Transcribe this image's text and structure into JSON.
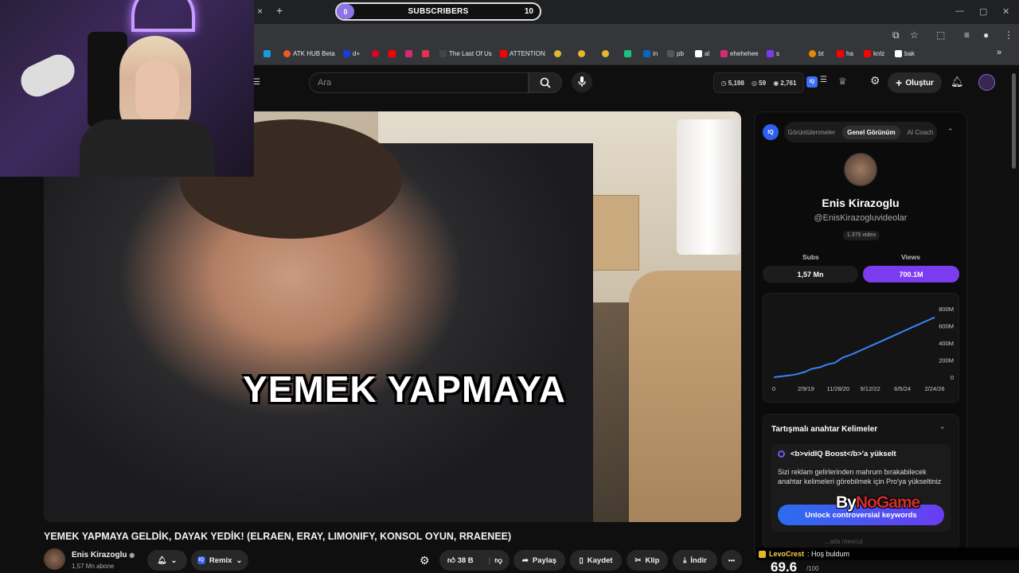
{
  "browser": {
    "tab_close": "×",
    "new_tab": "+",
    "subscribers_widget": {
      "current": "0",
      "label": "SUBSCRIBERS",
      "goal": "10"
    },
    "bookmarks": [
      {
        "label": "ATK HUB Beta",
        "color": "#f05a24"
      },
      {
        "label": "d+",
        "color": "#1a3bd6"
      },
      {
        "label": "",
        "color": "#e60023"
      },
      {
        "label": "",
        "color": "#d62976"
      },
      {
        "label": "",
        "color": "#e5334b"
      },
      {
        "label": "The Last Of Us",
        "color": "#444"
      },
      {
        "label": "ATTENTION",
        "color": "#ff0000"
      },
      {
        "label": "in",
        "color": "#0a66c2"
      },
      {
        "label": "pb",
        "color": "#555"
      },
      {
        "label": "al",
        "color": "#fff"
      },
      {
        "label": "ehehehee",
        "color": "#d62976"
      },
      {
        "label": "s",
        "color": "#7b3cf0"
      },
      {
        "label": "bt",
        "color": "#e58a00"
      },
      {
        "label": "ha",
        "color": "#ff0000"
      },
      {
        "label": "knlz",
        "color": "#ff0000"
      },
      {
        "label": "bak",
        "color": "#fff"
      }
    ],
    "overflow": "»"
  },
  "youtube": {
    "search_placeholder": "Ara",
    "stats": {
      "a": "5,198",
      "b": "59",
      "c": "2,761"
    },
    "iq": "IQ",
    "create_label": "Oluştur"
  },
  "video": {
    "caption": "YEMEK YAPMAYA",
    "title": "YEMEK YAPMAYA GELDİK, DAYAK YEDİK! (ELRAEN, ERAY, LIMONIFY, KONSOL OYUN, RRAENEE)",
    "channel": "Enis Kirazoglu",
    "subscribers": "1,57 Mn abone",
    "remix": "Remix",
    "likes": "38 B",
    "share": "Paylaş",
    "save": "Kaydet",
    "clip": "Klip",
    "download": "İndir",
    "more": "•••"
  },
  "sidebar": {
    "logo": "IQ",
    "tabs": [
      "Görüntülenmeler",
      "Genel Görünüm",
      "AI Coach"
    ],
    "active_tab": 1,
    "name": "Enis Kirazoglu",
    "handle": "@EnisKirazogluvideolar",
    "video_count": "1.375 video",
    "subs_label": "Subs",
    "subs_value": "1,57 Mn",
    "views_label": "Views",
    "views_value": "700.1M",
    "keywords_title": "Tartışmalı anahtar Kelimeler",
    "boost_title": "<b>vidIQ Boost</b>'a yükselt",
    "boost_desc": "Sizi reklam gelirlerinden mahrum bırakabilecek anahtar kelimeleri görebilmek için Pro'ya yükseltiniz",
    "unlock_label": "Unlock controversial keywords",
    "faint_text": "...atla mevcut",
    "score": "69.6",
    "score_max": "/100"
  },
  "chat": {
    "user": "LevoCrest",
    "message": ": Hoş buldum"
  },
  "watermark": {
    "a": "By",
    "b": "NoGame"
  },
  "chart_data": {
    "type": "line",
    "x_ticks": [
      "0",
      "2/9/19",
      "11/28/20",
      "9/12/22",
      "6/5/24",
      "2/24/26"
    ],
    "y_ticks": [
      "800M",
      "600M",
      "400M",
      "200M",
      "0"
    ],
    "ylim": [
      0,
      800
    ],
    "series": [
      {
        "values": [
          0,
          10,
          20,
          35,
          60,
          100,
          115,
          150,
          170,
          230,
          260,
          300,
          340,
          380,
          420,
          460,
          500,
          540,
          580,
          620,
          660,
          700
        ]
      }
    ],
    "line_color": "#3b82f6"
  },
  "colors": {
    "accent": "#7b3cf0",
    "iq_blue": "#2e5ff0"
  }
}
